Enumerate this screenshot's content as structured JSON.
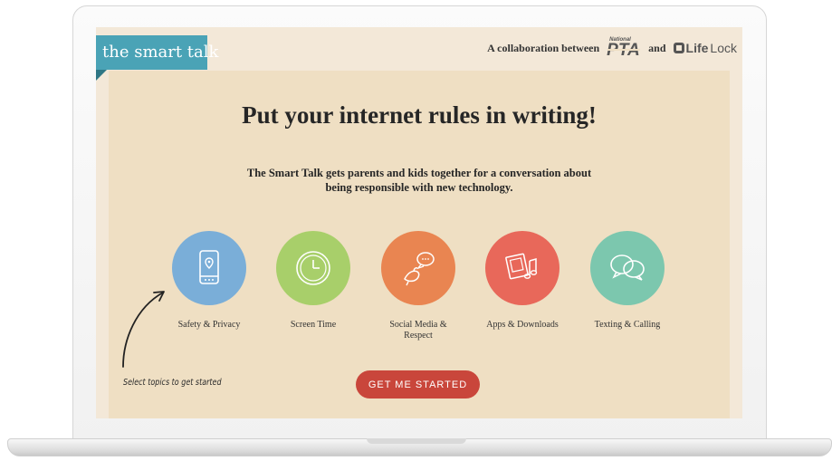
{
  "header": {
    "brand": "the smart talk",
    "collab_text": "A collaboration between",
    "pta_small": "National",
    "pta_big": "PTA",
    "and_text": "and",
    "lifelock_bold": "Life",
    "lifelock_light": "Lock"
  },
  "main": {
    "headline": "Put your internet rules in writing!",
    "subline_1": "The Smart Talk gets parents and kids together for a conversation about",
    "subline_2": "being responsible with new technology.",
    "topics": [
      {
        "label": "Safety & Privacy",
        "color": "#7aaed8",
        "icon": "phone-location-icon"
      },
      {
        "label": "Screen Time",
        "color": "#a8cf6a",
        "icon": "clock-icon"
      },
      {
        "label_1": "Social Media &",
        "label_2": "Respect",
        "color": "#e98551",
        "icon": "bird-chat-icon"
      },
      {
        "label": "Apps & Downloads",
        "color": "#e8685a",
        "icon": "photo-music-icon"
      },
      {
        "label": "Texting & Calling",
        "color": "#7cc7ae",
        "icon": "speech-bubbles-icon"
      }
    ],
    "hint": "Select topics to get started",
    "cta": "GET ME STARTED"
  },
  "colors": {
    "brand_teal": "#4aa3b6",
    "cta_red": "#c9463b",
    "background": "#f3e8d8"
  }
}
